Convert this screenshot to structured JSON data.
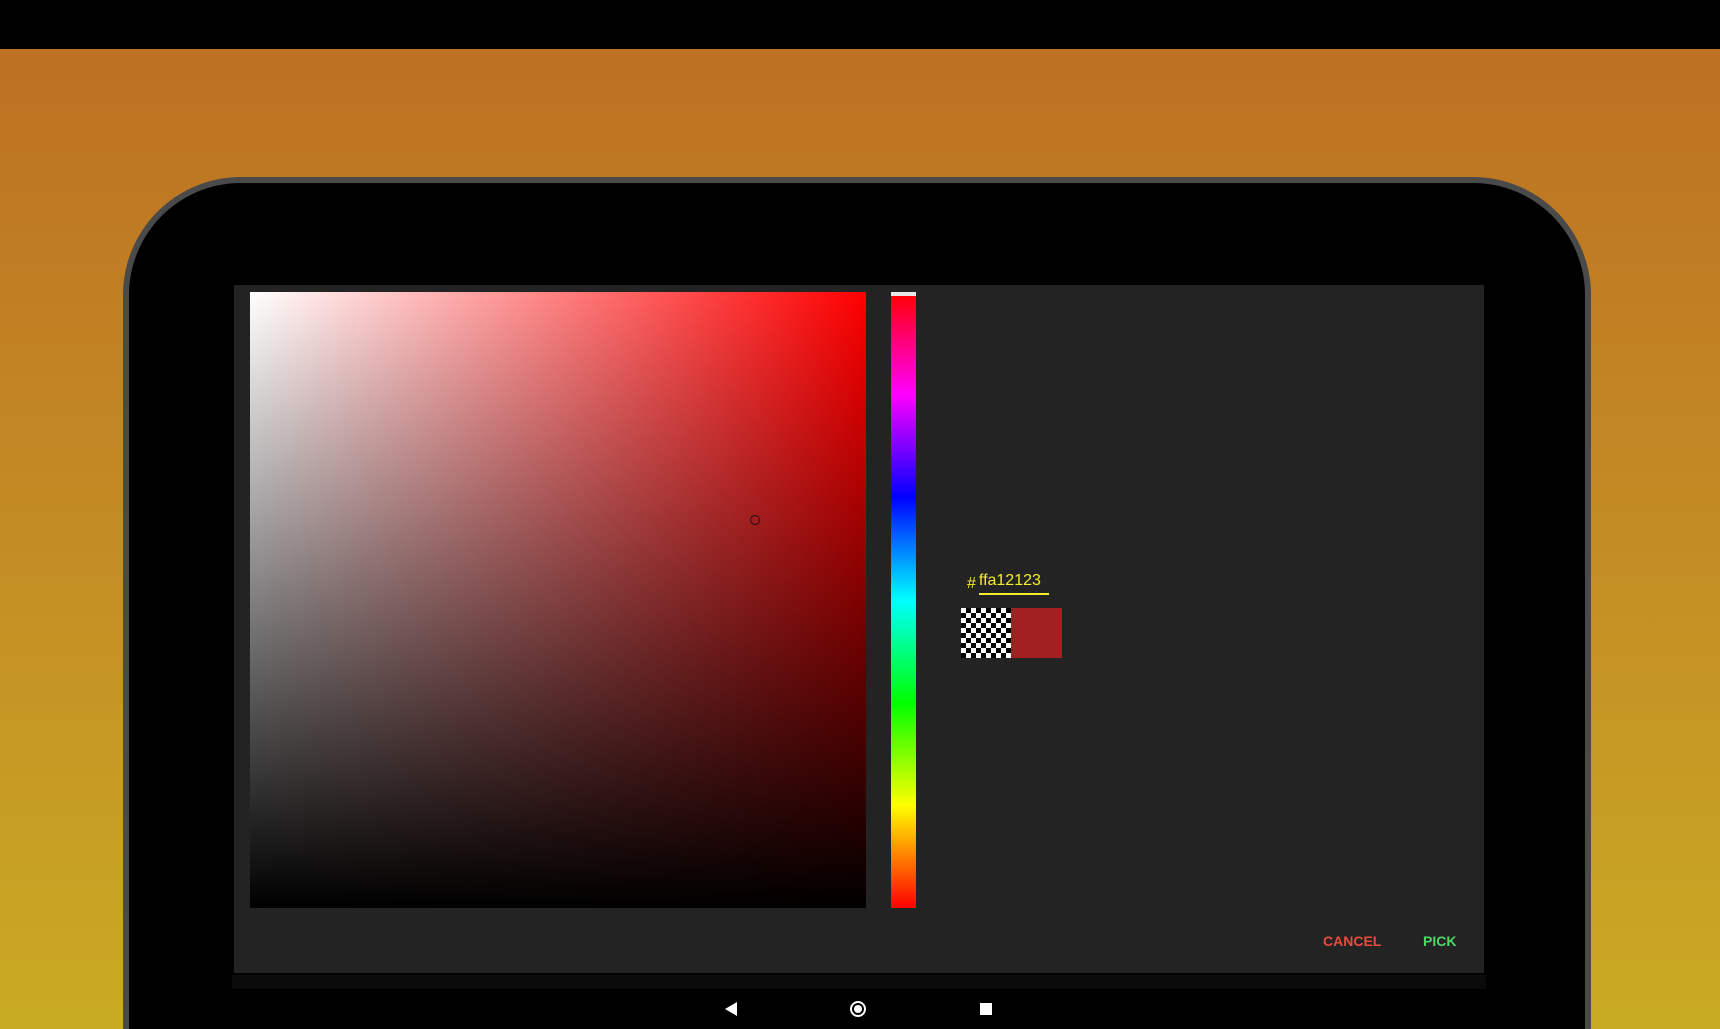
{
  "picker": {
    "hue_degrees": 0,
    "saturation": 0.82,
    "value": 0.63,
    "alpha": 1.0
  },
  "hex": {
    "prefix": "#",
    "value": "ffa12123"
  },
  "preview": {
    "new_color": "#a12123"
  },
  "actions": {
    "cancel_label": "CANCEL",
    "pick_label": "PICK"
  },
  "colors": {
    "hex_accent": "#f4ec2c",
    "cancel_color": "#e84c3d",
    "pick_color": "#4cd964",
    "dialog_background": "#232323",
    "wallpaper": "#c48e24"
  },
  "navigation": {
    "back_icon": "back-triangle-icon",
    "home_icon": "home-circle-icon",
    "recents_icon": "recents-square-icon"
  }
}
